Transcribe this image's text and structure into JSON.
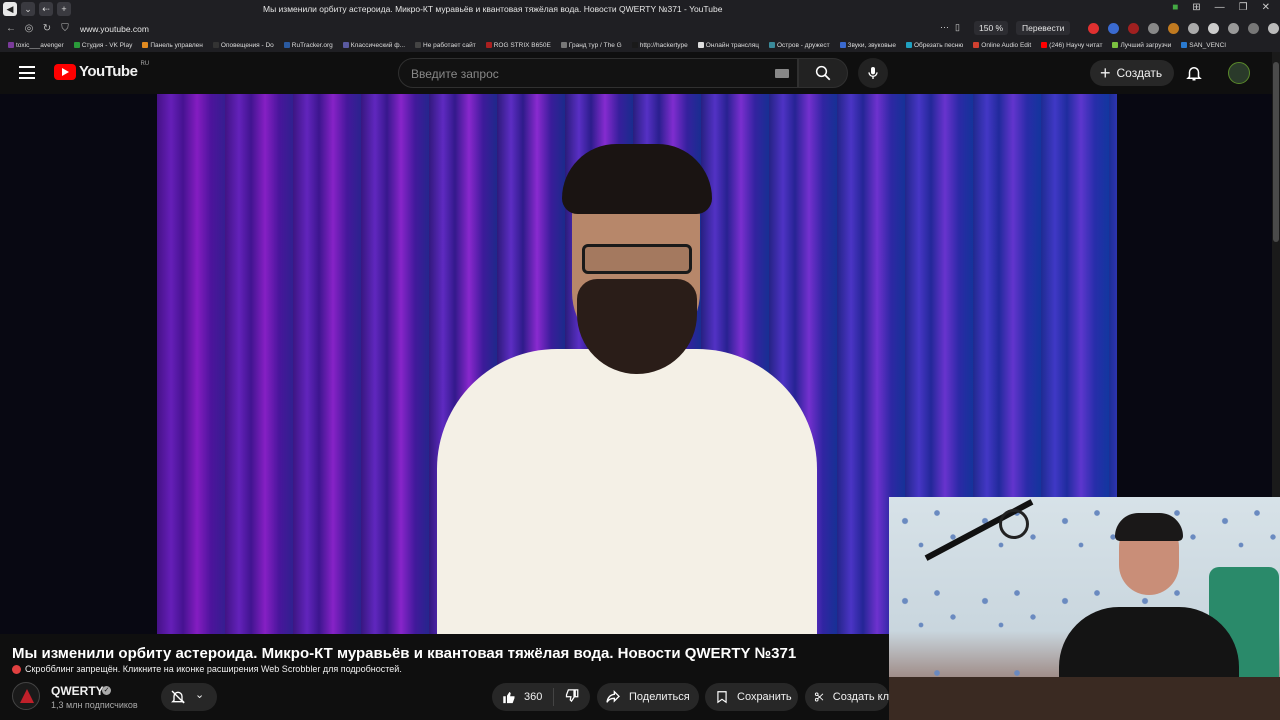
{
  "browser": {
    "page_title": "Мы изменили орбиту астероида. Микро-КТ муравьёв и квантовая тяжёлая вода. Новости QWERTY №371 - YouTube",
    "url": "www.youtube.com",
    "zoom": "150 %",
    "translate_label": "Перевести"
  },
  "bookmarks": [
    {
      "label": "toxic___avenger",
      "color": "#7a3a9a"
    },
    {
      "label": "Студия - VK Play",
      "color": "#2a9a3a"
    },
    {
      "label": "Панель управлен",
      "color": "#e08a20"
    },
    {
      "label": "Оповещения - Do",
      "color": "#333333"
    },
    {
      "label": "RuTracker.org",
      "color": "#2a5aa0"
    },
    {
      "label": "Классический ф...",
      "color": "#5a5aa0"
    },
    {
      "label": "Не работает сайт",
      "color": "#444444"
    },
    {
      "label": "ROG STRIX B650E",
      "color": "#aa2020"
    },
    {
      "label": "Гранд тур / The G",
      "color": "#777777"
    },
    {
      "label": "http://hackertype",
      "color": "#1a1a1a"
    },
    {
      "label": "Онлайн трансляц",
      "color": "#dddddd"
    },
    {
      "label": "Остров - дружест",
      "color": "#3a8a9a"
    },
    {
      "label": "Звуки, звуковые",
      "color": "#3a6ad0"
    },
    {
      "label": "Обрезать песню",
      "color": "#20a0c0"
    },
    {
      "label": "Online Audio Edit",
      "color": "#d04030"
    },
    {
      "label": "(246) Научу читат",
      "color": "#ff0000"
    },
    {
      "label": "Лучший загрузчи",
      "color": "#7ac040"
    },
    {
      "label": "SAN_VENCI",
      "color": "#2a7ad0"
    }
  ],
  "youtube": {
    "logo_text": "YouTube",
    "country_code": "RU",
    "search_placeholder": "Введите запрос",
    "create_label": "Создать"
  },
  "video": {
    "title": "Мы изменили орбиту астероида. Микро-КТ муравьёв и квантовая тяжёлая вода. Новости QWERTY №371",
    "scrobble_notice": "Скробблинг запрещён. Кликните на иконке расширения Web Scrobbler для подробностей.",
    "channel_name": "QWERTY",
    "subscribers": "1,3 млн подписчиков",
    "like_count": "360",
    "share_label": "Поделиться",
    "save_label": "Сохранить",
    "clip_label": "Создать кл"
  }
}
